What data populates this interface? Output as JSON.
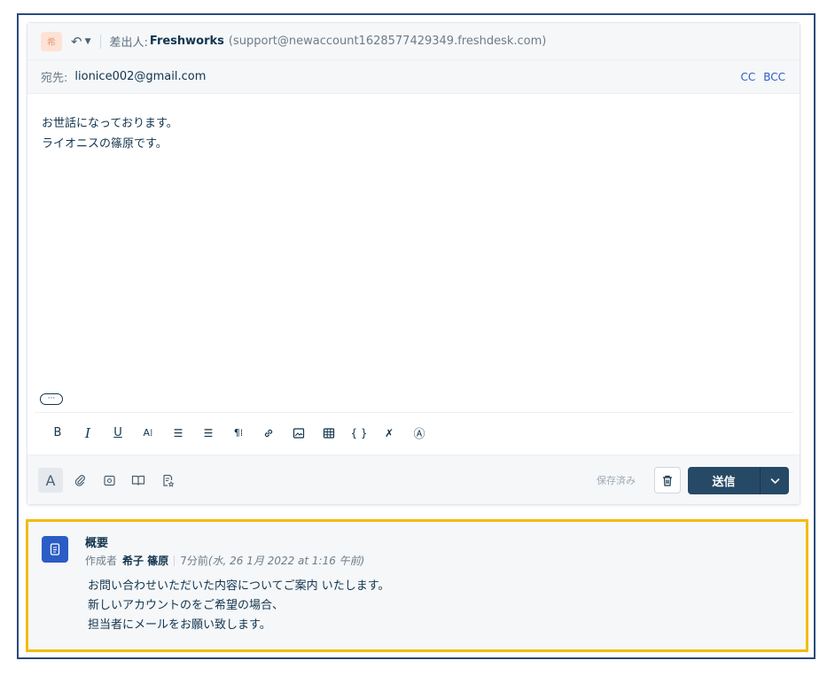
{
  "from": {
    "avatar_text": "希",
    "label": "差出人:",
    "name": "Freshworks",
    "email": "(support@newaccount1628577429349.freshdesk.com)"
  },
  "to": {
    "label": "宛先:",
    "value": "lionice002@gmail.com",
    "cc": "CC",
    "bcc": "BCC"
  },
  "body": {
    "lines": [
      "お世話になっております。",
      "ライオニスの篠原です。"
    ],
    "more_glyph": "···"
  },
  "toolbar": {
    "bold": "B",
    "italic": "I",
    "underline": "U",
    "font_size": "A⁞",
    "ordered_list": "☰",
    "unordered_list": "☰",
    "paragraph": "¶⁞",
    "link": "🔗",
    "image": "▣",
    "table": "⊞",
    "code": "{ }",
    "clear_format": "✗",
    "ai": "Ⓐ"
  },
  "actions": {
    "format_toggle": "A",
    "saved_label": "保存済み",
    "send_label": "送信",
    "send_dropdown_glyph": "⌄"
  },
  "icons": {
    "reply": "reply-icon",
    "chevron": "chevron-down-icon",
    "attach": "paperclip-icon",
    "canned": "canned-response-icon",
    "kb": "book-icon",
    "survey": "survey-icon",
    "trash": "trash-icon",
    "summary": "document-icon"
  },
  "summary": {
    "title": "概要",
    "author_label": "作成者",
    "author": "希子 篠原",
    "time_ago": "7分前",
    "timestamp": "(水, 26 1月 2022 at 1:16 午前)",
    "lines": [
      "お問い合わせいただいた内容についてご案内 いたします。",
      "新しいアカウントのをご希望の場合、",
      "担当者にメールをお願い致します。"
    ]
  },
  "colors": {
    "accent": "#2c5cc5",
    "send_button": "#264966",
    "highlight_border": "#f2bc0f",
    "frame_border": "#2c4a7c"
  }
}
